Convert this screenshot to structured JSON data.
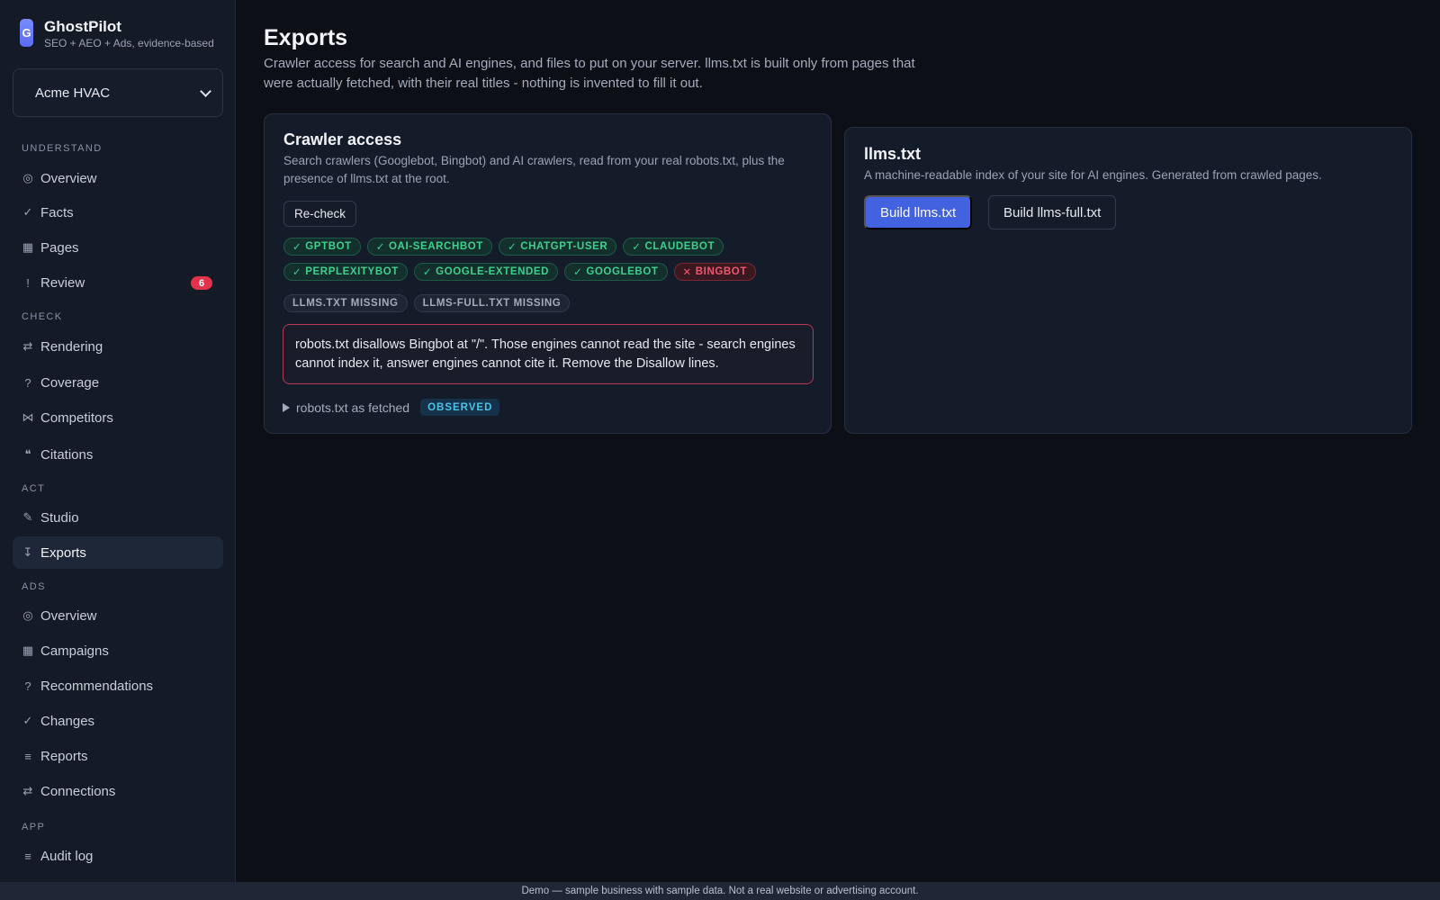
{
  "brand": {
    "logo_letter": "G",
    "name": "GhostPilot",
    "tagline": "SEO + AEO + Ads, evidence-based"
  },
  "site_selector": {
    "value": "Acme HVAC"
  },
  "sidebar": {
    "sections": [
      {
        "label": "UNDERSTAND"
      },
      {
        "label": "CHECK"
      },
      {
        "label": "ACT"
      },
      {
        "label": "ADS"
      },
      {
        "label": "APP"
      }
    ],
    "items": [
      {
        "icon": "◎",
        "label": "Overview"
      },
      {
        "icon": "✓",
        "label": "Facts"
      },
      {
        "icon": "▦",
        "label": "Pages"
      },
      {
        "icon": "!",
        "label": "Review",
        "badge": "6"
      },
      {
        "icon": "⇄",
        "label": "Rendering"
      },
      {
        "icon": "?",
        "label": "Coverage"
      },
      {
        "icon": "⋈",
        "label": "Competitors"
      },
      {
        "icon": "❝",
        "label": "Citations"
      },
      {
        "icon": "✎",
        "label": "Studio"
      },
      {
        "icon": "↧",
        "label": "Exports"
      },
      {
        "icon": "◎",
        "label": "Overview"
      },
      {
        "icon": "▦",
        "label": "Campaigns"
      },
      {
        "icon": "?",
        "label": "Recommendations"
      },
      {
        "icon": "✓",
        "label": "Changes"
      },
      {
        "icon": "≡",
        "label": "Reports"
      },
      {
        "icon": "⇄",
        "label": "Connections"
      },
      {
        "icon": "≡",
        "label": "Audit log"
      }
    ]
  },
  "page": {
    "title": "Exports",
    "description": "Crawler access for search and AI engines, and files to put on your server. llms.txt is built only from pages that were actually fetched, with their real titles - nothing is invented to fill it out."
  },
  "crawler_card": {
    "title": "Crawler access",
    "description": "Search crawlers (Googlebot, Bingbot) and AI crawlers, read from your real robots.txt, plus the presence of llms.txt at the root.",
    "recheck_label": "Re-check",
    "crawlers": [
      {
        "mark": "✓",
        "name": "GPTBOT"
      },
      {
        "mark": "✓",
        "name": "OAI-SEARCHBOT"
      },
      {
        "mark": "✓",
        "name": "CHATGPT-USER"
      },
      {
        "mark": "✓",
        "name": "CLAUDEBOT"
      },
      {
        "mark": "✓",
        "name": "PERPLEXITYBOT"
      },
      {
        "mark": "✓",
        "name": "GOOGLE-EXTENDED"
      },
      {
        "mark": "✓",
        "name": "GOOGLEBOT"
      },
      {
        "mark": "✕",
        "name": "BINGBOT"
      }
    ],
    "files": [
      "LLMS.TXT MISSING",
      "LLMS-FULL.TXT MISSING"
    ],
    "alert": "robots.txt disallows Bingbot at \"/\". Those engines cannot read the site - search engines cannot index it, answer engines cannot cite it. Remove the Disallow lines.",
    "details_label": "robots.txt as fetched",
    "details_badge": "OBSERVED"
  },
  "llms_card": {
    "title": "llms.txt",
    "description": "A machine-readable index of your site for AI engines. Generated from crawled pages.",
    "build_label": "Build llms.txt",
    "build_full_label": "Build llms-full.txt"
  },
  "footer": {
    "text": "Demo — sample business with sample data. Not a real website or advertising account."
  },
  "colors": {
    "accent": "#4262e0",
    "ok": "#3fd08e",
    "bad": "#f0566f",
    "badge": "#e0334c"
  }
}
